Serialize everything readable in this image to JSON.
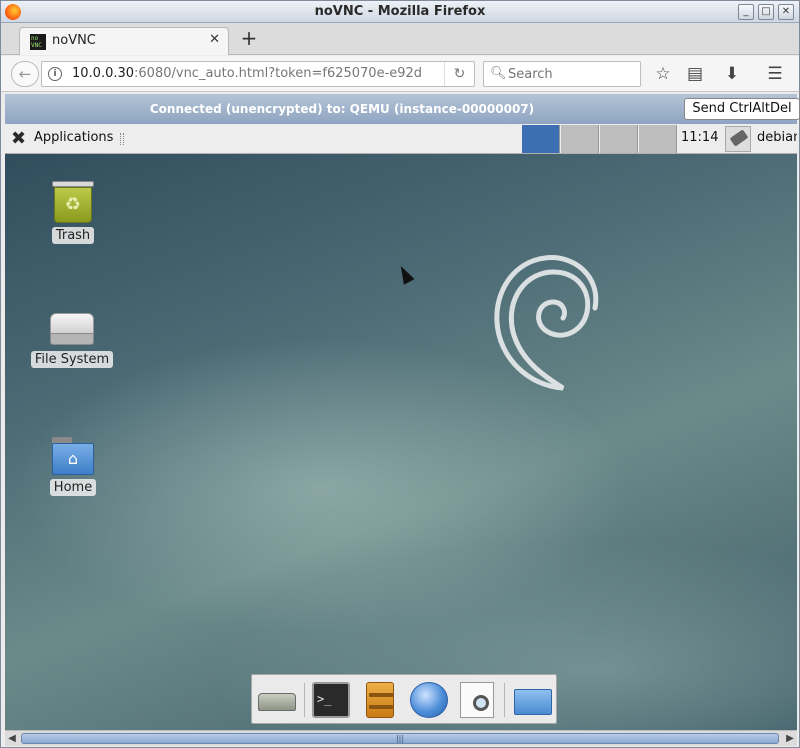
{
  "window": {
    "title": "noVNC - Mozilla Firefox"
  },
  "tabs": [
    {
      "label": "noVNC",
      "favicon_text": "noVNC"
    }
  ],
  "navbar": {
    "url_host": "10.0.0.30",
    "url_rest": ":6080/vnc_auto.html?token=f625070e-e92d",
    "search_placeholder": "Search"
  },
  "vnc": {
    "status": "Connected (unencrypted) to: QEMU (instance-00000007)",
    "send_cad_label": "Send CtrlAltDel"
  },
  "panel": {
    "applications_label": "Applications",
    "workspaces": [
      {
        "active": true
      },
      {
        "active": false
      },
      {
        "active": false
      },
      {
        "active": false
      }
    ],
    "clock": "11:14",
    "user": "debian"
  },
  "desktop_icons": [
    {
      "label": "Trash",
      "icon": "trash-icon"
    },
    {
      "label": "File System",
      "icon": "drive-icon"
    },
    {
      "label": "Home",
      "icon": "home-folder-icon"
    }
  ],
  "dock_items": [
    {
      "icon": "show-desktop-icon"
    },
    {
      "icon": "terminal-icon",
      "text": ">_"
    },
    {
      "icon": "file-manager-icon"
    },
    {
      "icon": "web-browser-icon"
    },
    {
      "icon": "app-finder-icon"
    },
    {
      "icon": "folder-icon"
    }
  ],
  "colors": {
    "vnc_bar": "#8ea4c1",
    "active_workspace": "#3b6eb3",
    "desktop_bg": "#4d6c76"
  }
}
